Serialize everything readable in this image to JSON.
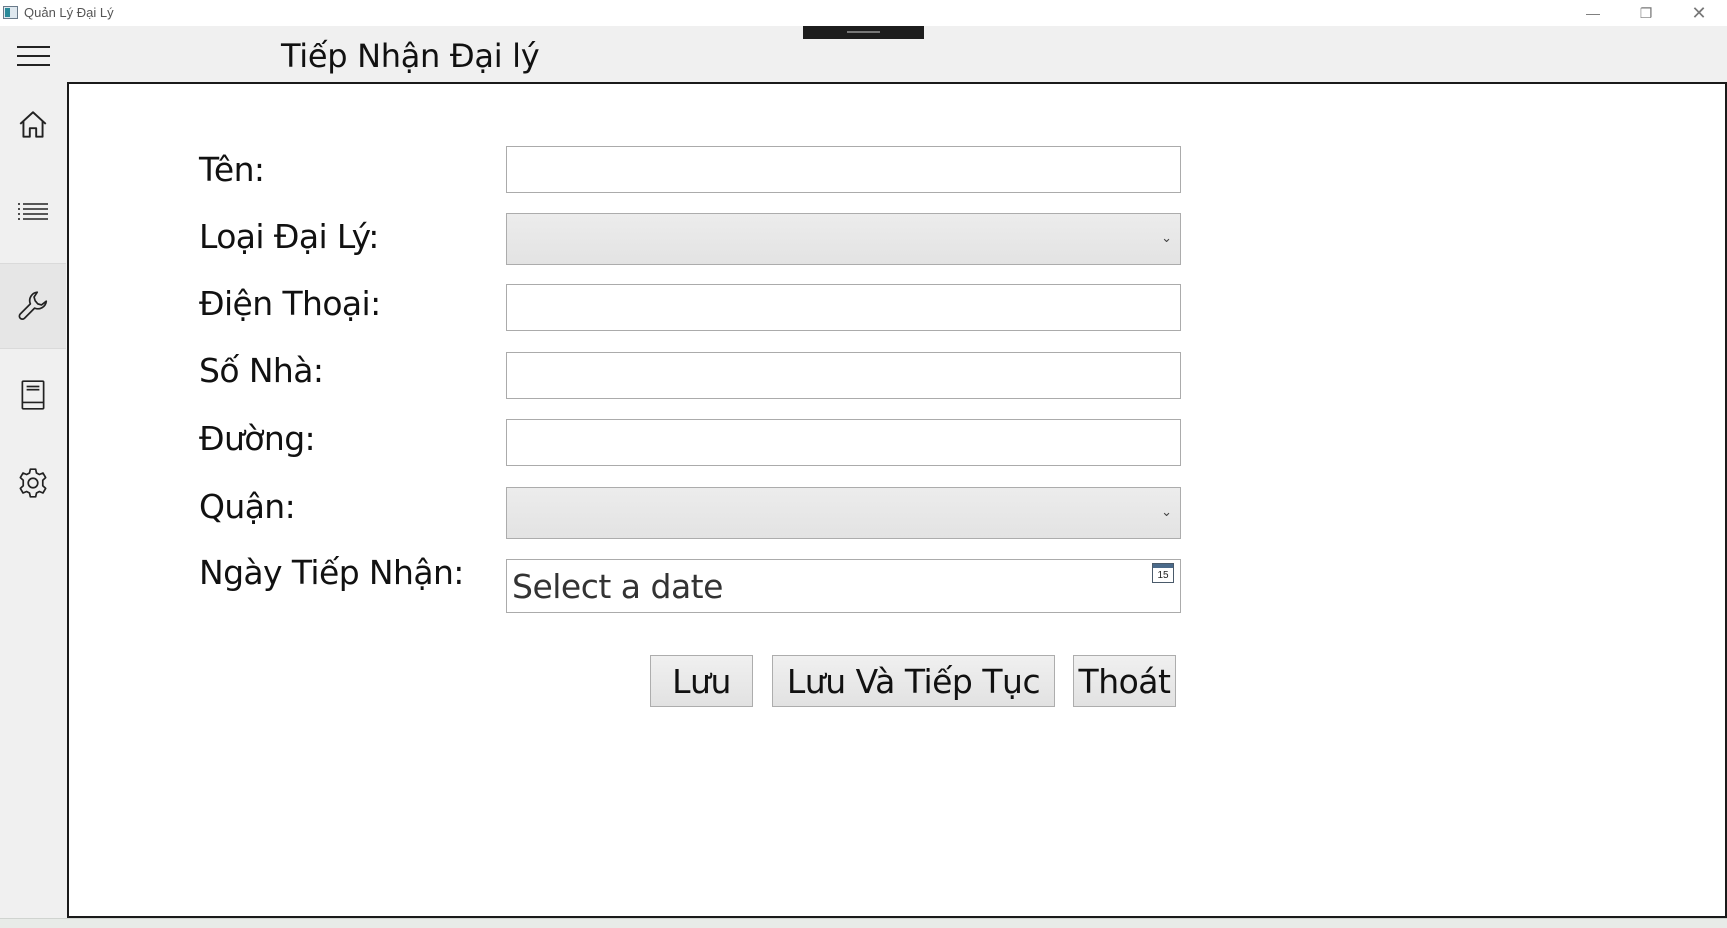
{
  "window": {
    "title": "Quản Lý Đại Lý",
    "minimize_glyph": "—",
    "maximize_glyph": "❐",
    "close_glyph": "✕"
  },
  "header": {
    "page_title": "Tiếp Nhận Đại lý"
  },
  "sidebar": {
    "items": [
      {
        "icon": "home-icon"
      },
      {
        "icon": "list-icon"
      },
      {
        "icon": "wrench-icon",
        "active": true
      },
      {
        "icon": "book-icon"
      },
      {
        "icon": "gear-icon"
      }
    ]
  },
  "form": {
    "name_label": "Tên:",
    "name_value": "",
    "type_label": "Loại Đại Lý:",
    "type_value": "",
    "phone_label": "Điện Thoại:",
    "phone_value": "",
    "house_label": "Số Nhà:",
    "house_value": "",
    "street_label": "Đường:",
    "street_value": "",
    "district_label": "Quận:",
    "district_value": "",
    "date_label": "Ngày Tiếp Nhận:",
    "date_placeholder": "Select a date",
    "calendar_day": "15"
  },
  "actions": {
    "save_label": "Lưu",
    "save_continue_label": "Lưu Và Tiếp Tục",
    "exit_label": "Thoát"
  }
}
